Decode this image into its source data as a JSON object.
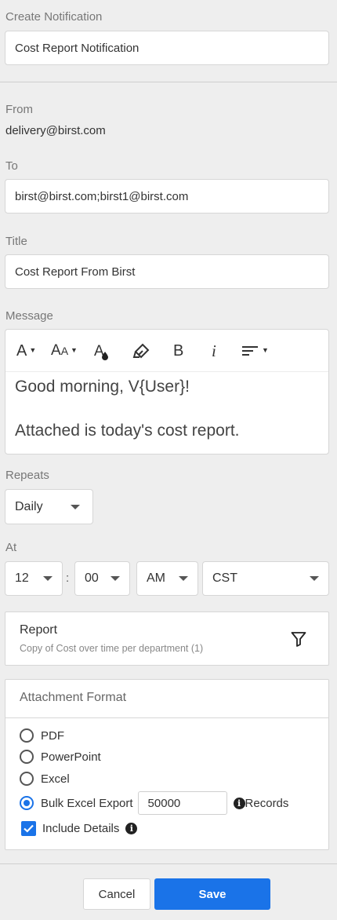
{
  "header": {
    "title": "Create Notification",
    "name_value": "Cost Report Notification"
  },
  "from": {
    "label": "From",
    "value": "delivery@birst.com"
  },
  "to": {
    "label": "To",
    "value": "birst@birst.com;birst1@birst.com"
  },
  "title_field": {
    "label": "Title",
    "value": "Cost Report From Birst"
  },
  "message": {
    "label": "Message",
    "toolbar": {
      "font_icon": "font-color-icon",
      "size_icon": "font-size-icon",
      "fill_icon": "fill-color-icon",
      "highlight_icon": "highlighter-icon",
      "bold_label": "B",
      "italic_label": "i",
      "align_icon": "align-left-icon"
    },
    "lines": [
      "Good morning, V{User}!",
      "Attached is today's cost report."
    ]
  },
  "repeats": {
    "label": "Repeats",
    "value": "Daily"
  },
  "at": {
    "label": "At",
    "hour": "12",
    "separator": ":",
    "minute": "00",
    "ampm": "AM",
    "timezone": "CST"
  },
  "report": {
    "title": "Report",
    "subtitle": "Copy of Cost over time per department (1)",
    "filter_icon": "filter-icon"
  },
  "attachment": {
    "title": "Attachment Format",
    "options": [
      {
        "label": "PDF",
        "selected": false
      },
      {
        "label": "PowerPoint",
        "selected": false
      },
      {
        "label": "Excel",
        "selected": false
      },
      {
        "label": "Bulk Excel Export",
        "selected": true
      }
    ],
    "records_value": "50000",
    "records_label": "Records",
    "include_details_label": "Include Details",
    "include_details_checked": true
  },
  "footer": {
    "cancel_label": "Cancel",
    "save_label": "Save"
  },
  "colors": {
    "accent": "#1a73e8",
    "background": "#eeeeee"
  }
}
